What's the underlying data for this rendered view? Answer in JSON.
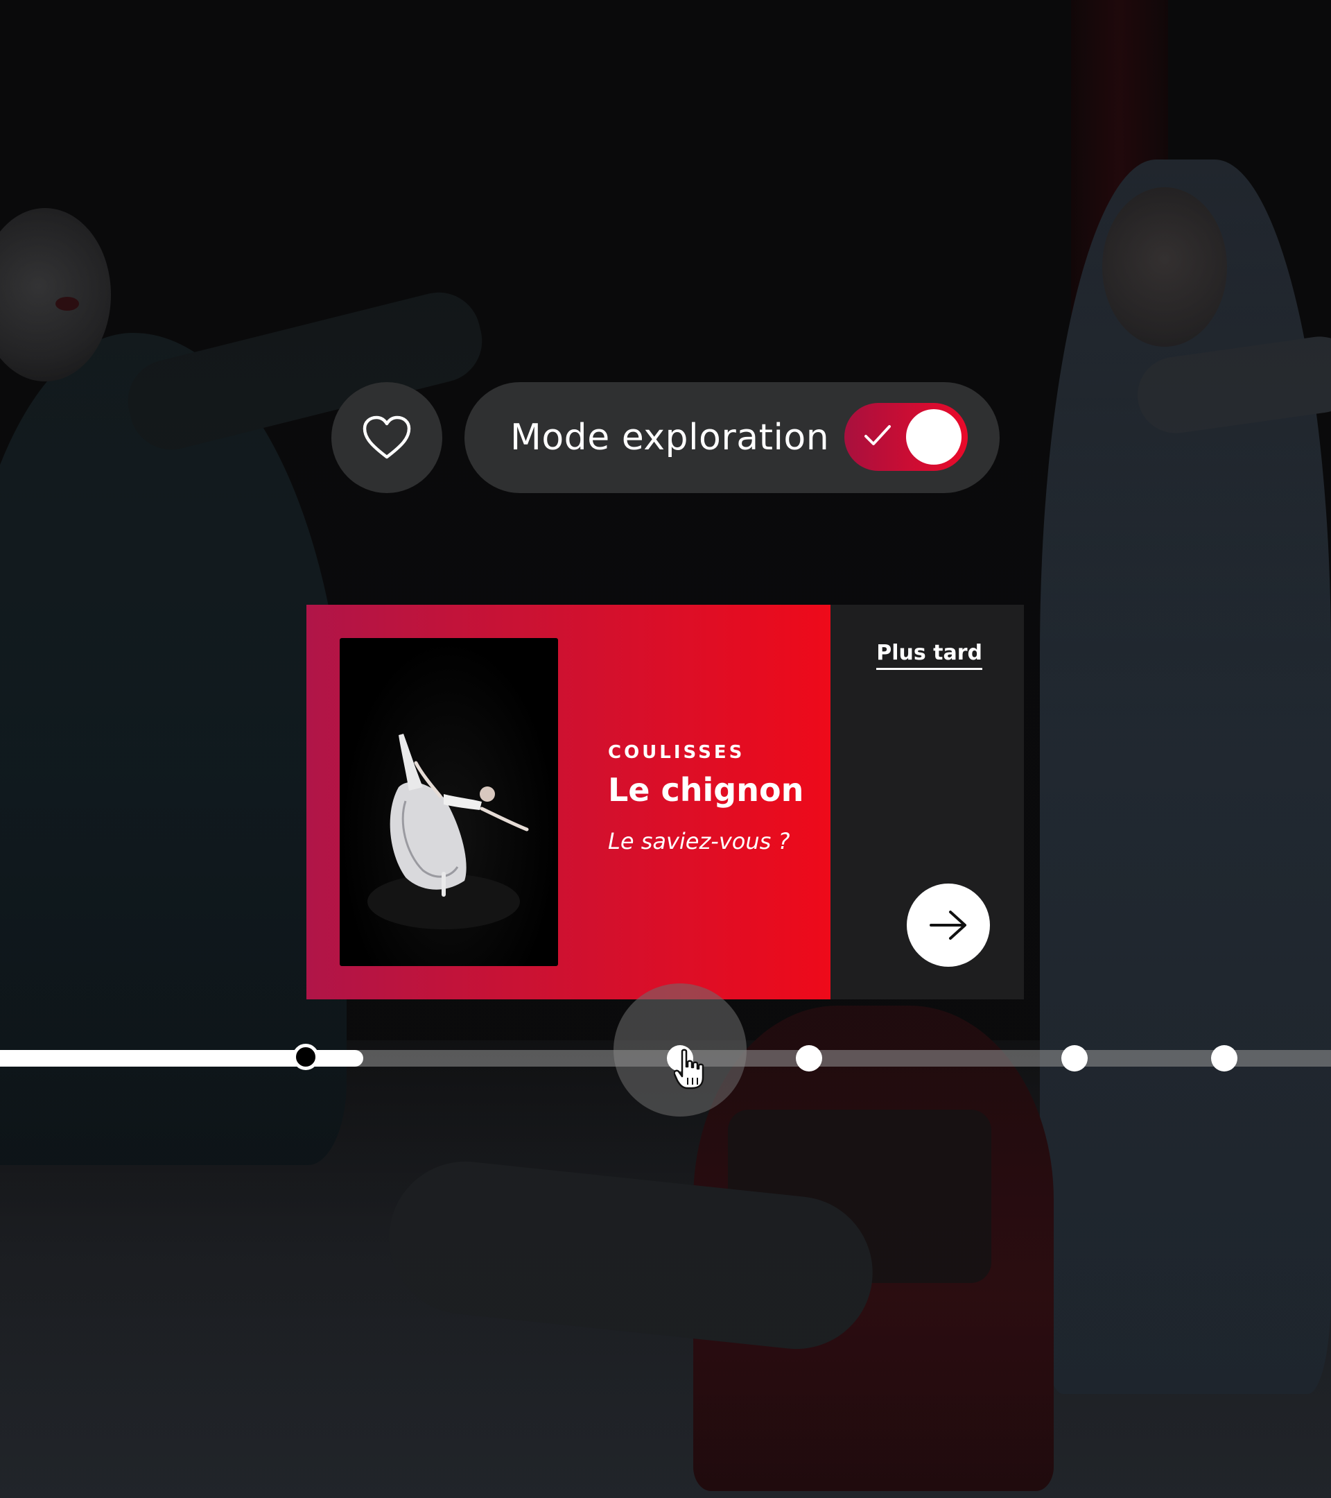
{
  "header": {
    "favorite_icon": "heart-icon",
    "mode_toggle": {
      "label": "Mode exploration",
      "enabled": true,
      "check_icon": "check-icon",
      "accent_from": "#a8103e",
      "accent_to": "#ea0a2a"
    }
  },
  "card": {
    "eyebrow": "COULISSES",
    "title": "Le chignon",
    "subtitle": "Le saviez-vous ?",
    "thumbnail": "ballerina-arabesque-image",
    "later_label": "Plus tard",
    "next_icon": "arrow-right-icon",
    "gradient_from": "#b01548",
    "gradient_to": "#ee0a1a"
  },
  "timeline": {
    "progress": 0.27,
    "node_count": 6,
    "current_index": 0,
    "hovered_index": 1
  },
  "colors": {
    "background": "#0c0c0d",
    "pill": "#2f3031",
    "card_side": "#1e1e1f"
  }
}
